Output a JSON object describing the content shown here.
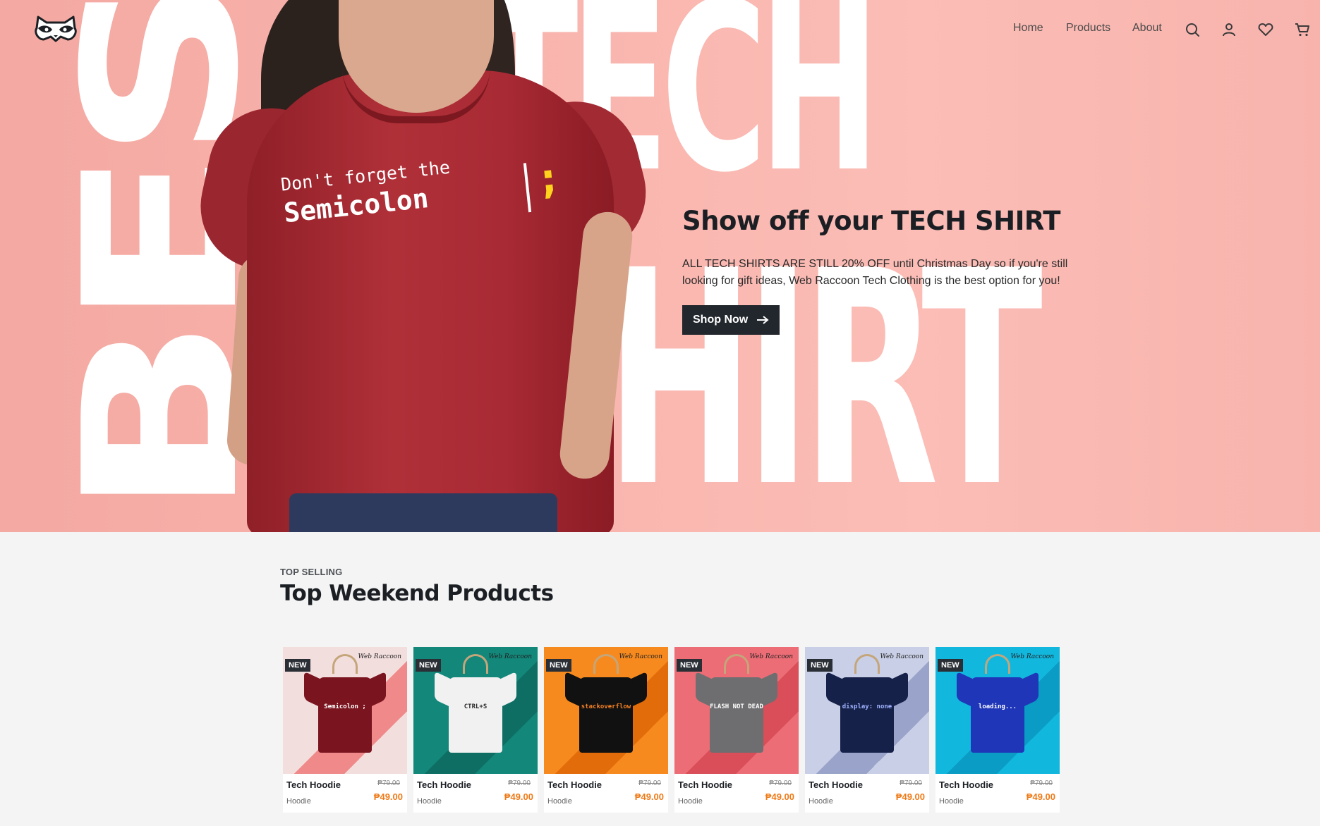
{
  "header": {
    "logo": "raccoon-logo",
    "nav": [
      {
        "label": "Home"
      },
      {
        "label": "Products"
      },
      {
        "label": "About"
      }
    ],
    "icons": [
      "search-icon",
      "user-icon",
      "heart-icon",
      "cart-icon"
    ]
  },
  "hero": {
    "bg_word_1": "BEST",
    "bg_word_2": "TECH",
    "bg_word_3": "SHIRT",
    "shirt_line_1": "Don't forget the",
    "shirt_line_2": "Semicolon",
    "shirt_symbol": ";",
    "title": "Show off your TECH SHIRT",
    "description": "ALL TECH SHIRTS ARE STILL 20% OFF until Christmas Day so if you're still looking for gift ideas, Web Raccoon Tech Clothing is the best option for you!",
    "cta_label": "Shop Now",
    "cta_icon": "arrow-right-icon"
  },
  "products_section": {
    "label": "TOP SELLING",
    "title": "Top Weekend Products",
    "items": [
      {
        "badge": "NEW",
        "brand": "Web Raccoon",
        "name": "Tech Hoodie",
        "category": "Hoodie",
        "old_price": "₱79.00",
        "price": "₱49.00",
        "bg": "#f3dede",
        "accent": "#f08a8a",
        "shirt": "#7a1520",
        "print": "Semicolon ;",
        "print_color": "#ffffff"
      },
      {
        "badge": "NEW",
        "brand": "Web Raccoon",
        "name": "Tech Hoodie",
        "category": "Hoodie",
        "old_price": "₱79.00",
        "price": "₱49.00",
        "bg": "#12877a",
        "accent": "#0e6e63",
        "shirt": "#f1f1f1",
        "print": "CTRL+S",
        "print_color": "#2a2a2a"
      },
      {
        "badge": "NEW",
        "brand": "Web Raccoon",
        "name": "Tech Hoodie",
        "category": "Hoodie",
        "old_price": "₱79.00",
        "price": "₱49.00",
        "bg": "#f78a1f",
        "accent": "#e36c0a",
        "shirt": "#111111",
        "print": "stackoverflow",
        "print_color": "#f48024"
      },
      {
        "badge": "NEW",
        "brand": "Web Raccoon",
        "name": "Tech Hoodie",
        "category": "Hoodie",
        "old_price": "₱79.00",
        "price": "₱49.00",
        "bg": "#ec6d76",
        "accent": "#d94e58",
        "shirt": "#6e6e70",
        "print": "FLASH NOT DEAD",
        "print_color": "#ffffff"
      },
      {
        "badge": "NEW",
        "brand": "Web Raccoon",
        "name": "Tech Hoodie",
        "category": "Hoodie",
        "old_price": "₱79.00",
        "price": "₱49.00",
        "bg": "#c9cfe6",
        "accent": "#9aa3c9",
        "shirt": "#16214a",
        "print": "display: none",
        "print_color": "#9fb3ff"
      },
      {
        "badge": "NEW",
        "brand": "Web Raccoon",
        "name": "Tech Hoodie",
        "category": "Hoodie",
        "old_price": "₱79.00",
        "price": "₱49.00",
        "bg": "#12b7de",
        "accent": "#0a9cc4",
        "shirt": "#1f36b8",
        "print": "loading...",
        "print_color": "#ffffff"
      }
    ]
  }
}
